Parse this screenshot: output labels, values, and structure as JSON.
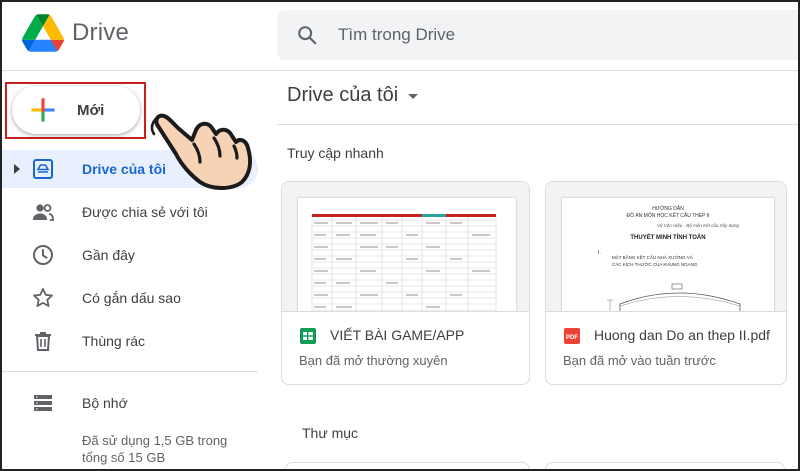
{
  "app": {
    "name": "Drive"
  },
  "search": {
    "placeholder": "Tìm trong Drive"
  },
  "new_button": {
    "label": "Mới"
  },
  "sidebar": {
    "items": [
      {
        "label": "Drive của tôi",
        "icon": "my-drive-icon",
        "active": true
      },
      {
        "label": "Được chia sẻ với tôi",
        "icon": "shared-people-icon"
      },
      {
        "label": "Gần đây",
        "icon": "clock-icon"
      },
      {
        "label": "Có gắn dấu sao",
        "icon": "star-icon"
      },
      {
        "label": "Thùng rác",
        "icon": "trash-icon"
      }
    ],
    "storage": {
      "label": "Bộ nhớ",
      "icon": "storage-icon",
      "usage": "Đã sử dụng 1,5 GB trong tổng số 15 GB"
    }
  },
  "main": {
    "breadcrumb": "Drive của tôi",
    "quick_access_title": "Truy cập nhanh",
    "folders_title": "Thư mục",
    "files": [
      {
        "name": "VIẾT BÀI GAME/APP",
        "subtitle": "Bạn đã mở thường xuyên",
        "type": "google-sheets-icon"
      },
      {
        "name": "Huong dan Do an thep II.pdf",
        "subtitle": "Bạn đã mở vào tuần trước",
        "type": "pdf-icon"
      }
    ],
    "pdf_preview": {
      "line1": "HƯỚNG DẪN",
      "line2": "ĐỒ ÁN MÔN HỌC KẾT CẤU THÉP II",
      "line3": "Vũ Văn Hiệu - Bộ môn Kết cấu Xây dựng",
      "heading": "THUYẾT MINH TÍNH TOÁN",
      "item_num": "I.",
      "item_text1": "MẶT BẰNG KẾT CẤU NHÀ XƯỞNG VÀ",
      "item_text2": "CÁC KÍCH THƯỚC CỦA KHUNG NGANG"
    }
  },
  "colors": {
    "accent": "#1967d2",
    "active_bg": "#e8f0fe",
    "highlight_box": "#c5221f",
    "sheets_green": "#0f9d58",
    "pdf_red": "#ea4335"
  }
}
